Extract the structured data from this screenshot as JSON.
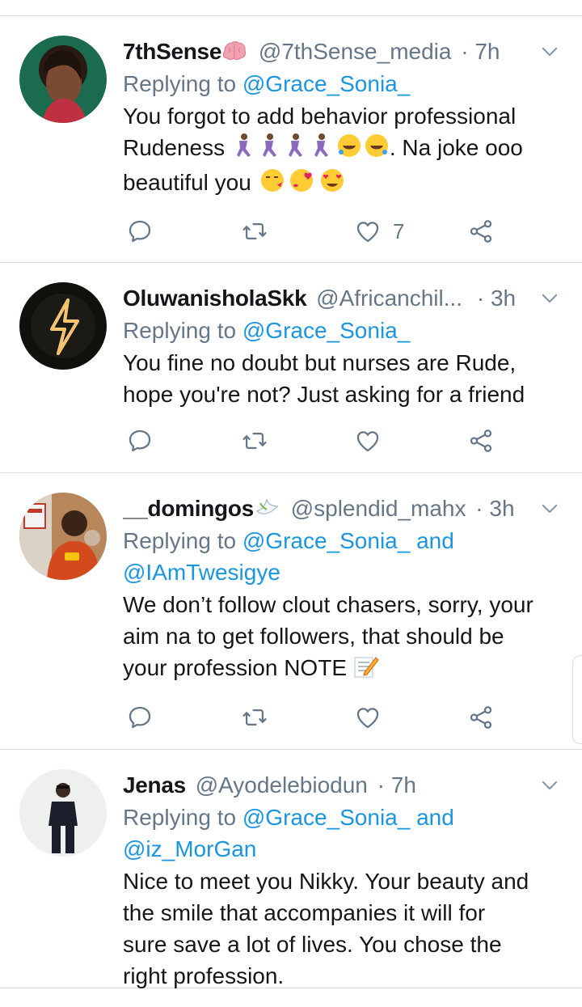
{
  "tweets": [
    {
      "name": "7thSense",
      "name_emoji": "brain-emoji",
      "handle": "@7thSense_media",
      "time": "· 7h",
      "replying_prefix": "Replying to ",
      "replying_to": "@Grace_Sonia_",
      "replying_and": "",
      "replying_to2": "",
      "text_lines": [
        "You forgot to add behavior professional",
        "Rudeness",
        ". Na joke ooo",
        "beautiful you"
      ],
      "likes": "7"
    },
    {
      "name": "OluwanisholaSkk",
      "handle": "@Africanchil...",
      "time": "· 3h",
      "replying_prefix": "Replying to ",
      "replying_to": "@Grace_Sonia_",
      "text": [
        "You fine no doubt but nurses are Rude,",
        "hope you're not? Just asking for a friend"
      ],
      "likes": ""
    },
    {
      "name": "__domingos",
      "name_emoji": "dove-emoji",
      "handle": "@splendid_mahx",
      "time": "· 3h",
      "replying_prefix": "Replying to ",
      "replying_to": "@Grace_Sonia_",
      "replying_and": " and",
      "replying_to2": "@IAmTwesigye",
      "text": [
        "We don’t follow clout chasers, sorry, your",
        "aim na to get followers, that should be",
        "your profession NOTE"
      ],
      "likes": ""
    },
    {
      "name": "Jenas",
      "handle": "@Ayodelebiodun",
      "time": "· 7h",
      "replying_prefix": "Replying to ",
      "replying_to": "@Grace_Sonia_",
      "replying_and": " and",
      "replying_to2": "@iz_MorGan",
      "text": [
        "Nice to meet you Nikky. Your beauty and",
        "the smile that accompanies it will for",
        "sure save a lot of lives. You chose the",
        "right profession."
      ]
    }
  ],
  "icons": [
    "reply-icon",
    "retweet-icon",
    "like-icon",
    "share-icon",
    "chevron-down-icon"
  ],
  "colors": {
    "link": "#1b95e0",
    "secondary": "#657786",
    "divider": "#d8dde2",
    "text": "#14171a"
  }
}
